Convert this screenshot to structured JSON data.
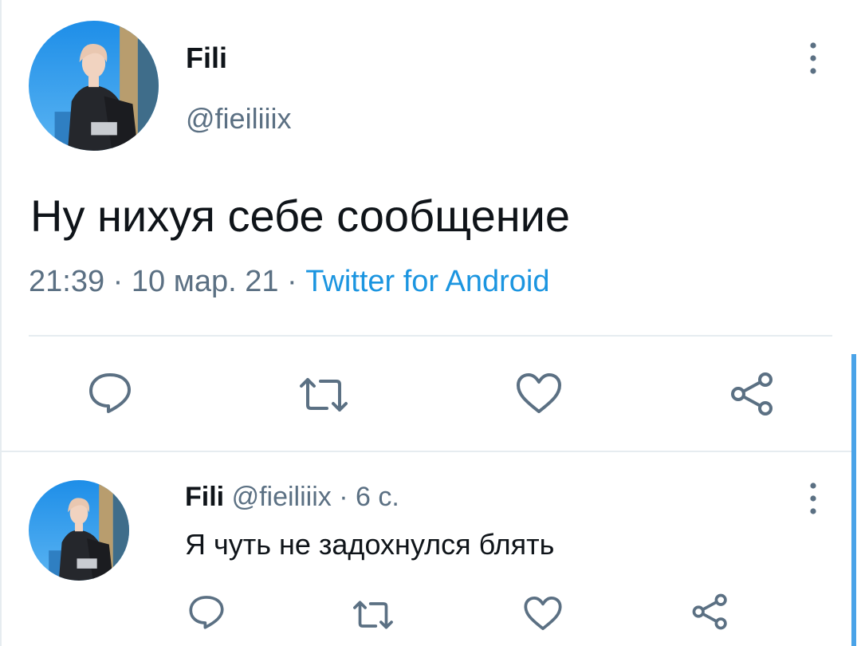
{
  "tweet": {
    "display_name": "Fili",
    "handle": "@fieiliiix",
    "text": "Ну нихуя себе сообщение",
    "time": "21:39",
    "separator": " · ",
    "date": "10 мар. 21",
    "source": "Twitter for Android"
  },
  "reply": {
    "display_name": "Fili",
    "handle": "@fieiliiix",
    "age": "6 с.",
    "separator": " · ",
    "text": "Я чуть не задохнулся блять"
  },
  "colors": {
    "text_primary": "#0f1419",
    "text_secondary": "#5b7083",
    "link": "#1b95e0",
    "icon": "#5b7083",
    "divider": "#e6ecf0",
    "scroll_indicator": "#4aa3e8"
  },
  "icons": [
    "more-vertical-icon",
    "reply-icon",
    "retweet-icon",
    "like-icon",
    "share-icon"
  ]
}
